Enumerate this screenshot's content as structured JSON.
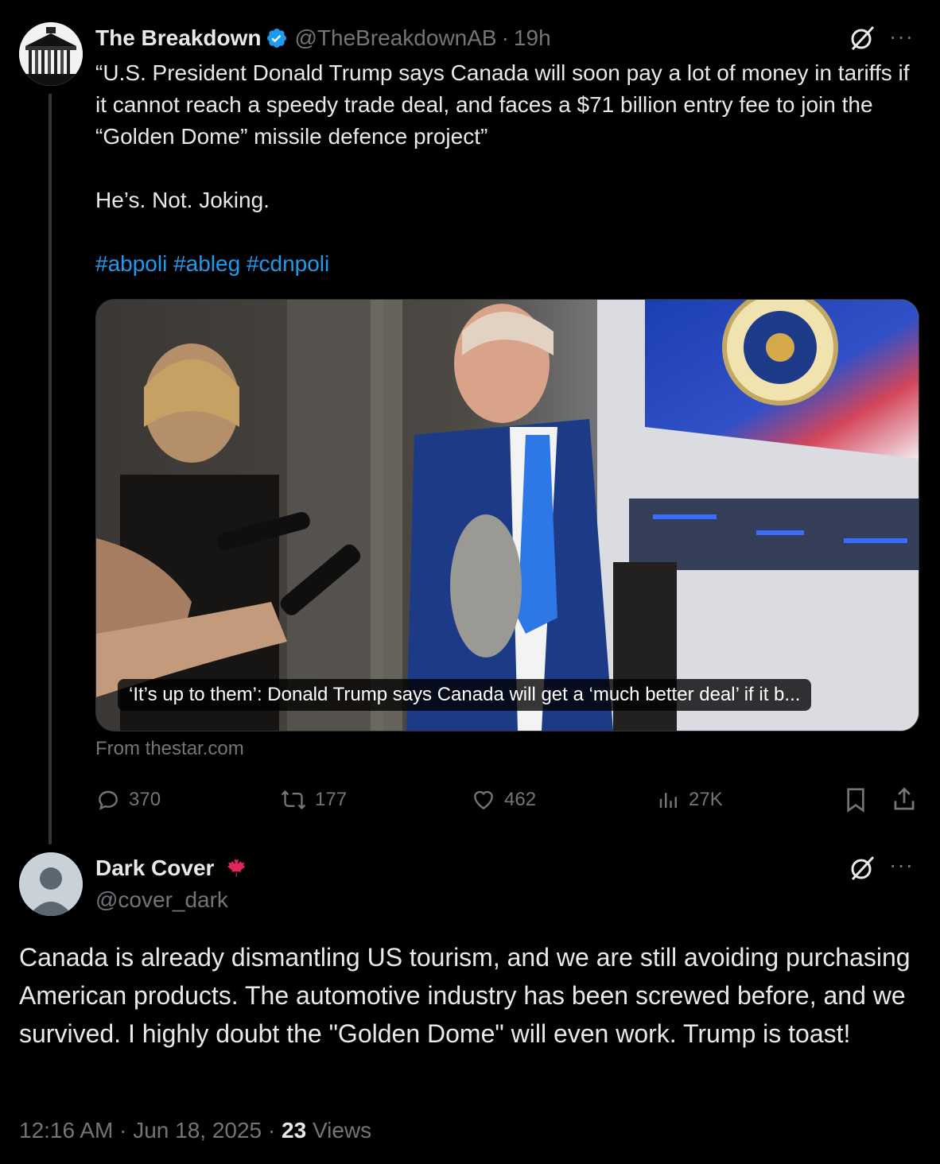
{
  "original_tweet": {
    "author_name": "The Breakdown",
    "handle": "@TheBreakdownAB",
    "time": "19h",
    "separator": "·",
    "text": "“U.S. President Donald Trump says Canada will soon pay a lot of money in tariffs if it cannot reach a speedy trade deal, and faces a $71 billion entry fee to join the “Golden Dome” missile defence project”",
    "text2": "He’s. Not. Joking.",
    "hashtags": "#abpoli #ableg #cdnpoli",
    "card": {
      "caption": "‘It’s up to them’: Donald Trump says Canada will get a ‘much better deal’ if it b...",
      "source": "From thestar.com"
    },
    "stats": {
      "replies": "370",
      "reposts": "177",
      "likes": "462",
      "views": "27K"
    },
    "icons": {
      "verified": "verified-badge-icon",
      "grok": "grok-icon",
      "more": "more-icon"
    }
  },
  "reply": {
    "author_name": "Dark Cover",
    "handle": "@cover_dark",
    "flag": "maple-leaf-icon",
    "text": "Canada is already dismantling US tourism, and we are still avoiding purchasing American products. The automotive industry has been screwed before, and we survived.  I highly doubt the \"Golden Dome\" will even work. Trump is toast!",
    "time": "12:16 AM",
    "date": "Jun 18, 2025",
    "views_count": "23",
    "views_label": "Views",
    "separator": "·"
  },
  "colors": {
    "background": "#000000",
    "text": "#e7e9ea",
    "muted": "#71767b",
    "link": "#1d9bf0",
    "verified": "#1d9bf0",
    "flag": "#e0245e"
  }
}
